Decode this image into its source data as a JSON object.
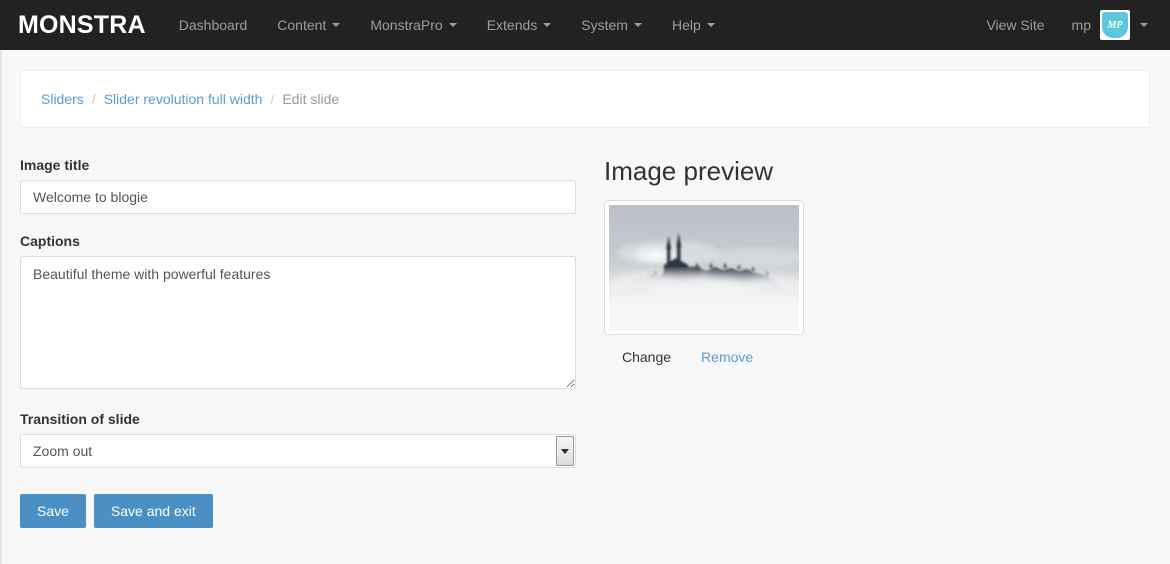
{
  "navbar": {
    "brand": "MONSTRA",
    "items": [
      {
        "label": "Dashboard",
        "caret": false
      },
      {
        "label": "Content",
        "caret": true
      },
      {
        "label": "MonstraPro",
        "caret": true
      },
      {
        "label": "Extends",
        "caret": true
      },
      {
        "label": "System",
        "caret": true
      },
      {
        "label": "Help",
        "caret": true
      }
    ],
    "view_site": "View Site",
    "username": "mp",
    "avatar_monogram": "MP",
    "background_color": "#222222",
    "text_color": "#9d9d9d",
    "avatar_color": "#5bc8dd"
  },
  "breadcrumb": {
    "items": [
      {
        "label": "Sliders",
        "active": false
      },
      {
        "label": "Slider revolution full width",
        "active": false
      },
      {
        "label": "Edit slide",
        "active": true
      }
    ],
    "separator": "/",
    "link_color": "#5b9bd5"
  },
  "form": {
    "image_title": {
      "label": "Image title",
      "value": "Welcome to blogie",
      "placeholder": ""
    },
    "captions": {
      "label": "Captions",
      "value": "Beautiful theme with powerful features",
      "placeholder": ""
    },
    "transition": {
      "label": "Transition of slide",
      "value": "Zoom out",
      "options": [
        "Zoom out"
      ]
    },
    "save_label": "Save",
    "save_exit_label": "Save and exit",
    "button_color": "#4a90c4"
  },
  "preview": {
    "title": "Image preview",
    "change_label": "Change",
    "remove_label": "Remove",
    "image_alt": "Foggy hilltop church above clouds"
  }
}
